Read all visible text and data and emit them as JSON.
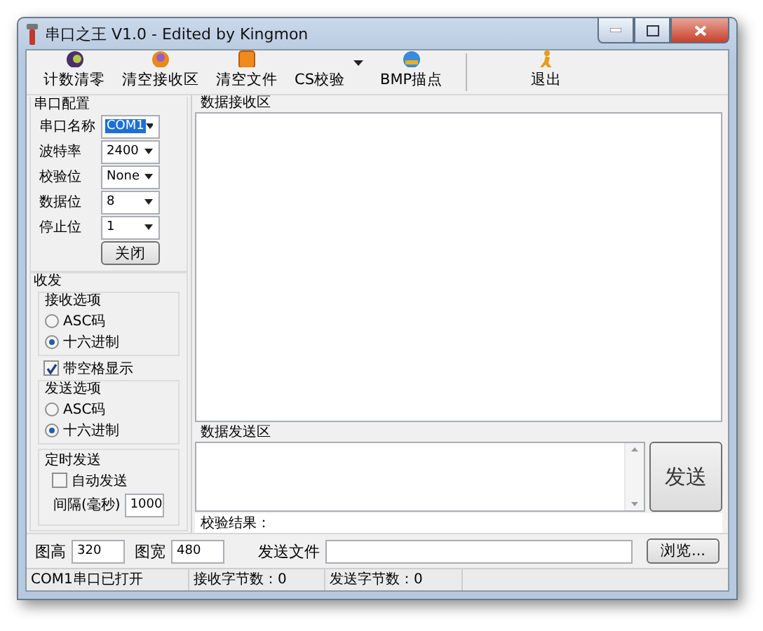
{
  "window": {
    "title": "串口之王 V1.0 - Edited by Kingmon"
  },
  "toolbar": {
    "buttons": [
      {
        "label": "计数清零",
        "kind": "button"
      },
      {
        "label": "清空接收区",
        "kind": "button"
      },
      {
        "label": "清空文件",
        "kind": "button"
      },
      {
        "label": "CS校验",
        "kind": "dropdown"
      },
      {
        "label": "BMP描点",
        "kind": "button"
      },
      {
        "label": "退出",
        "kind": "button"
      }
    ]
  },
  "serial_config": {
    "title": "串口配置",
    "fields": [
      {
        "label": "串口名称",
        "value": "COM1",
        "selected": true
      },
      {
        "label": "波特率",
        "value": "2400",
        "selected": false
      },
      {
        "label": "校验位",
        "value": "None",
        "selected": false
      },
      {
        "label": "数据位",
        "value": "8",
        "selected": false
      },
      {
        "label": "停止位",
        "value": "1",
        "selected": false
      }
    ],
    "close_button": "关闭"
  },
  "transceive": {
    "title": "收发",
    "receive_options": {
      "title": "接收选项",
      "options": [
        {
          "label": "ASC码",
          "selected": false
        },
        {
          "label": "十六进制",
          "selected": true
        }
      ]
    },
    "show_spaces": {
      "label": "带空格显示",
      "checked": true
    },
    "send_options": {
      "title": "发送选项",
      "options": [
        {
          "label": "ASC码",
          "selected": false
        },
        {
          "label": "十六进制",
          "selected": true
        }
      ]
    },
    "timed_send": {
      "title": "定时发送",
      "auto_send": {
        "label": "自动发送",
        "checked": false
      },
      "interval": {
        "label": "间隔(毫秒)",
        "value": "1000"
      }
    }
  },
  "receive_area": {
    "title": "数据接收区"
  },
  "send_area": {
    "title": "数据发送区",
    "send_button": "发送"
  },
  "checksum": {
    "label": "校验结果："
  },
  "bottom": {
    "image_height": {
      "label": "图高",
      "value": "320"
    },
    "image_width": {
      "label": "图宽",
      "value": "480"
    },
    "send_file": {
      "label": "发送文件"
    },
    "browse_button": "浏览..."
  },
  "status_bar": [
    "COM1串口已打开",
    "接收字节数：0",
    "发送字节数：0"
  ]
}
